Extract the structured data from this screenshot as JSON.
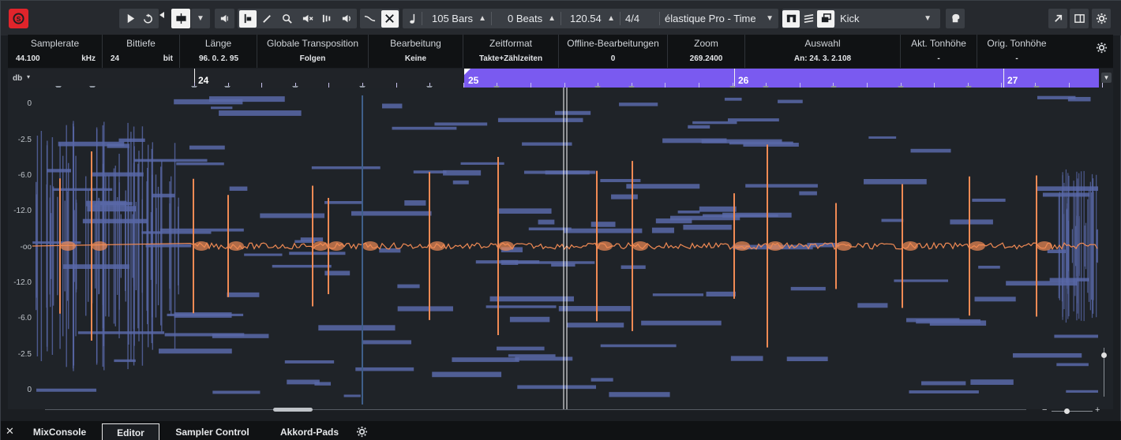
{
  "toolbar": {
    "length_value": "105 Bars",
    "beats_value": "0 Beats",
    "tempo_value": "120.54",
    "signature_value": "4/4",
    "algorithm_value": "élastique Pro - Time",
    "track_value": "Kick"
  },
  "info": [
    {
      "label": "Samplerate",
      "value": "44.100",
      "unit": "kHz"
    },
    {
      "label": "Bittiefe",
      "value": "24",
      "unit": "bit"
    },
    {
      "label": "Länge",
      "value": "96. 0. 2. 95",
      "unit": ""
    },
    {
      "label": "Globale Transposition",
      "value": "Folgen",
      "unit": ""
    },
    {
      "label": "Bearbeitung",
      "value": "Keine",
      "unit": ""
    },
    {
      "label": "Zeitformat",
      "value": "Takte+Zählzeiten",
      "unit": ""
    },
    {
      "label": "Offline-Bearbeitungen",
      "value": "0",
      "unit": ""
    },
    {
      "label": "Zoom",
      "value": "269.2400",
      "unit": ""
    },
    {
      "label": "Auswahl",
      "value": "An: 24. 3. 2.108",
      "unit": ""
    },
    {
      "label": "Akt. Tonhöhe",
      "value": "-",
      "unit": ""
    },
    {
      "label": "Orig. Tonhöhe",
      "value": "-",
      "unit": ""
    }
  ],
  "ruler": {
    "unit_label": "db",
    "bars": [
      "24",
      "25",
      "26",
      "27"
    ]
  },
  "db_scale": [
    "0",
    "-2.5",
    "-6.0",
    "-12.0",
    "-oo",
    "-12.0",
    "-6.0",
    "-2.5",
    "0"
  ],
  "zoom": {
    "minus": "−",
    "plus": "+"
  },
  "tabs": [
    "MixConsole",
    "Editor",
    "Sampler Control",
    "Akkord-Pads"
  ],
  "colors": {
    "accent": "#7a5af0",
    "waveform": "#f08a54",
    "spectral": "#5968a8",
    "record_red": "#e0242b"
  }
}
